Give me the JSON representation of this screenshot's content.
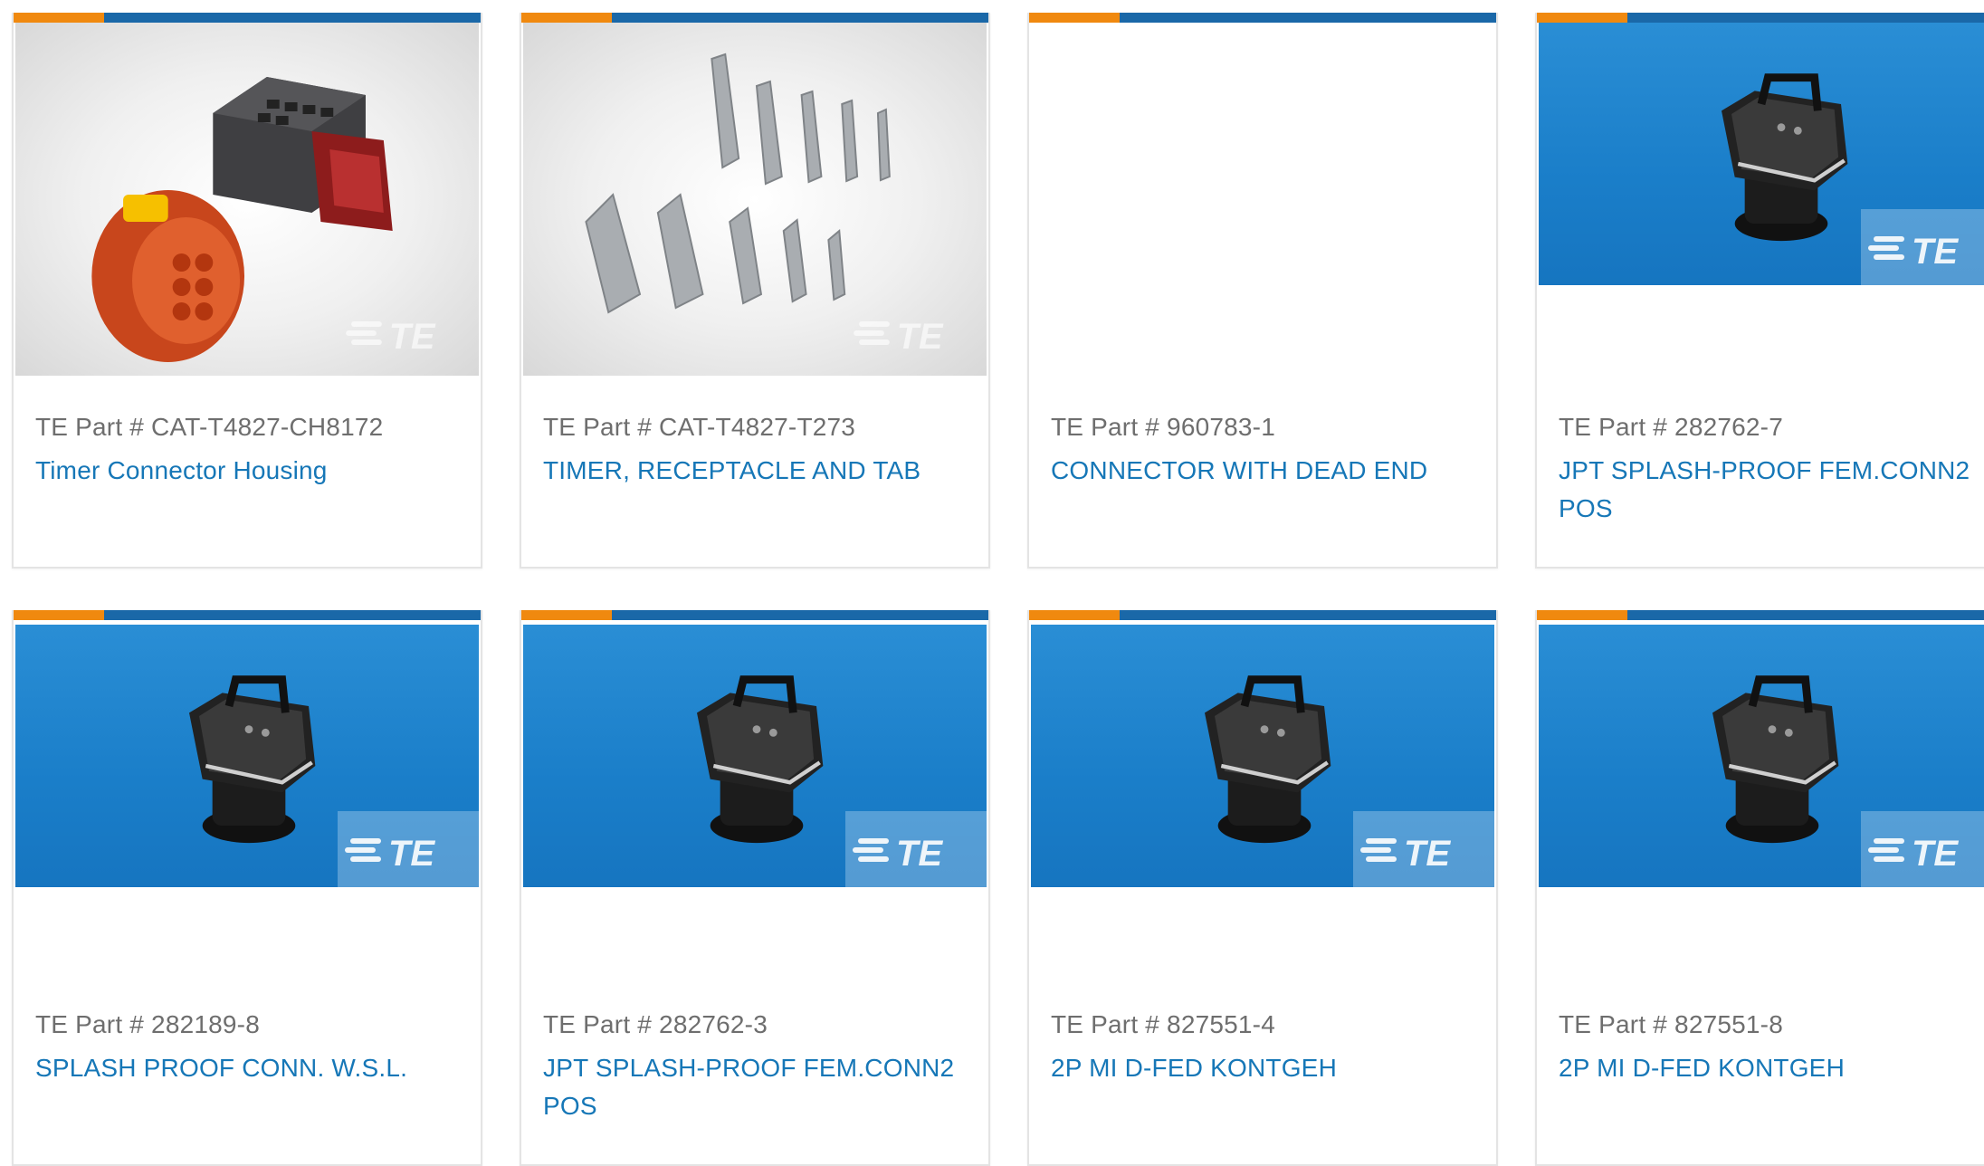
{
  "colors": {
    "accent": "#f0890f",
    "brand_blue": "#1a68a8",
    "link": "#1677b7",
    "part_text": "#6e6e6e"
  },
  "products": [
    {
      "part_label": "TE Part # CAT-T4827-CH8172",
      "title": "Timer Connector Housing",
      "image": "connector-housing-image"
    },
    {
      "part_label": "TE Part # CAT-T4827-T273",
      "title": "TIMER, RECEPTACLE AND TAB",
      "image": "terminals-image"
    },
    {
      "part_label": "TE Part # 960783-1",
      "title": "CONNECTOR WITH DEAD END",
      "image": ""
    },
    {
      "part_label": "TE Part # 282762-7",
      "title": "JPT SPLASH-PROOF FEM.CONN2 POS",
      "image": "splash-proof-connector-image"
    },
    {
      "part_label": "TE Part # 282189-8",
      "title": "SPLASH PROOF CONN. W.S.L.",
      "image": "splash-proof-connector-image"
    },
    {
      "part_label": "TE Part # 282762-3",
      "title": "JPT SPLASH-PROOF FEM.CONN2 POS",
      "image": "splash-proof-connector-image"
    },
    {
      "part_label": "TE Part # 827551-4",
      "title": "2P MI D-FED KONTGEH",
      "image": "splash-proof-connector-image"
    },
    {
      "part_label": "TE Part # 827551-8",
      "title": "2P MI D-FED KONTGEH",
      "image": "splash-proof-connector-image"
    }
  ]
}
